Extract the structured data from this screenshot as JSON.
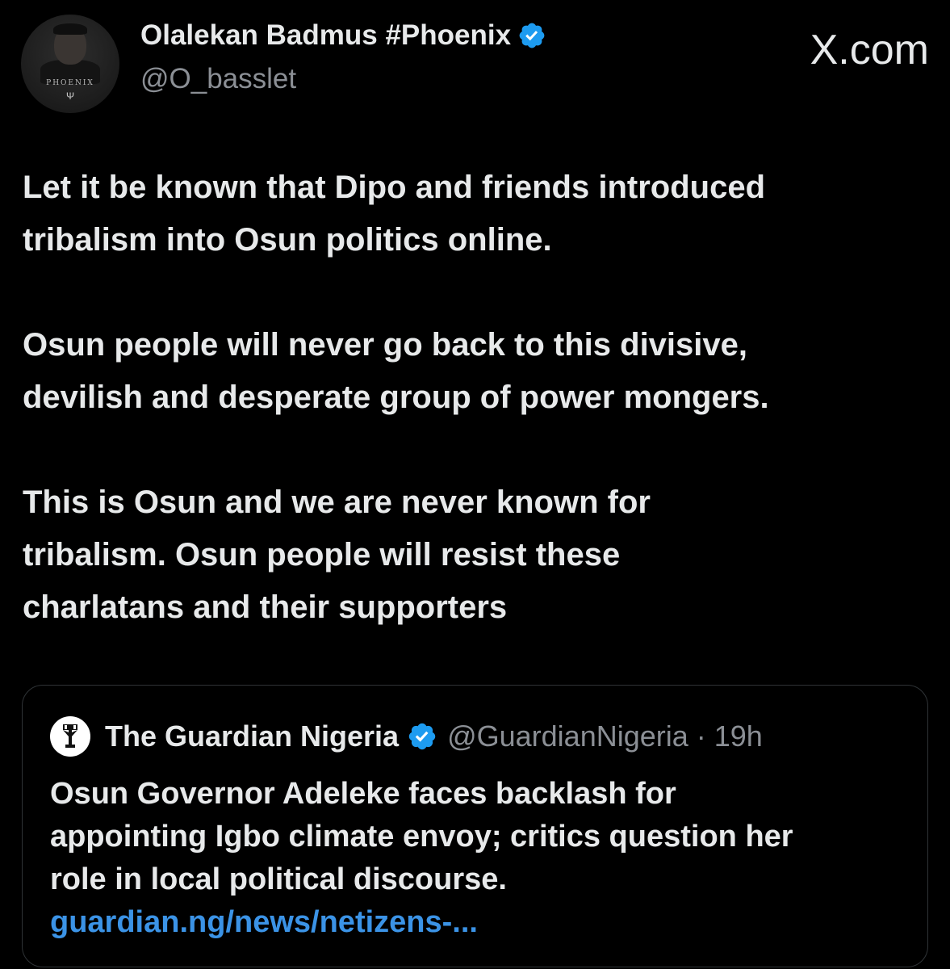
{
  "site": "X.com",
  "author": {
    "display_name": "Olalekan Badmus #Phoenix",
    "handle": "@O_basslet",
    "verified": true,
    "avatar_text": "PHOENIX",
    "avatar_mark": "Ψ"
  },
  "post": {
    "paragraphs": [
      [
        "Let it be known that Dipo and friends introduced",
        "tribalism into Osun politics online."
      ],
      [
        "Osun people will never go back to this divisive,",
        "devilish and desperate group of power mongers."
      ],
      [
        "This is Osun and we are never known for",
        "tribalism. Osun people will resist these",
        "charlatans and their supporters"
      ]
    ]
  },
  "quoted_post": {
    "display_name": "The Guardian Nigeria",
    "handle_time": "@GuardianNigeria · 19h",
    "verified": true,
    "text_lines": [
      "Osun Governor Adeleke faces backlash for",
      "appointing Igbo climate envoy; critics question her",
      "role in local political discourse."
    ],
    "link": "guardian.ng/news/netizens-..."
  },
  "colors": {
    "background": "#000000",
    "text": "#e7e9ea",
    "secondary_text": "#8b8f95",
    "verified_badge": "#1d9bf0",
    "link": "#3b93e6",
    "border": "#2f3336"
  }
}
